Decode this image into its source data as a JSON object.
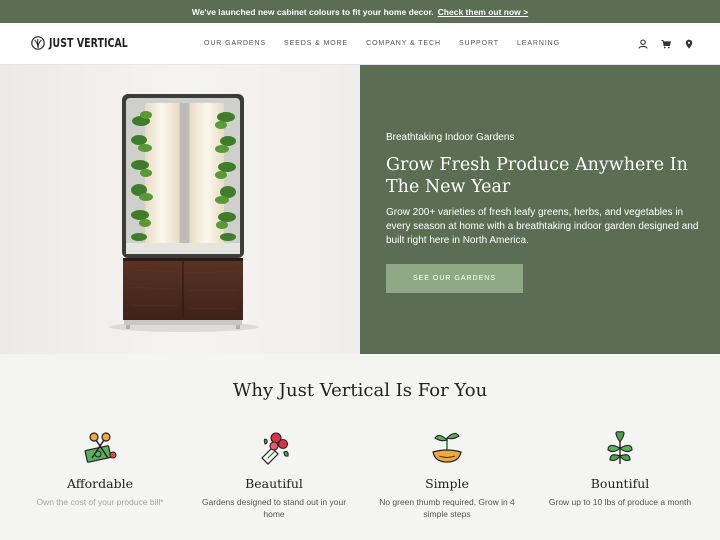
{
  "announcement": {
    "text": "We've launched new cabinet colours to fit your home decor.",
    "link": "Check them out now >"
  },
  "brand": {
    "name": "JUST VERTICAL"
  },
  "nav": {
    "items": [
      "OUR GARDENS",
      "SEEDS & MORE",
      "COMPANY & TECH",
      "SUPPORT",
      "LEARNING"
    ],
    "icons": [
      "user-icon",
      "cart-icon",
      "location-pin-icon"
    ]
  },
  "hero": {
    "eyebrow": "Breathtaking Indoor Gardens",
    "headline": "Grow Fresh Produce Anywhere In The New Year",
    "description": "Grow 200+ varieties of fresh leafy greens, herbs, and vegetables in every season at home with a breathtaking indoor garden designed and built right here in North America.",
    "cta": "SEE OUR GARDENS"
  },
  "why": {
    "title": "Why Just Vertical Is For You",
    "features": [
      {
        "icon": "scissors-money-icon",
        "title": "Affordable",
        "description": "Own the cost of your produce bill*"
      },
      {
        "icon": "flower-bouquet-icon",
        "title": "Beautiful",
        "description": "Gardens designed to stand out in your home"
      },
      {
        "icon": "seedling-hands-icon",
        "title": "Simple",
        "description": "No green thumb required. Grow in 4 simple steps"
      },
      {
        "icon": "leafy-plant-icon",
        "title": "Bountiful",
        "description": "Grow up to 10 lbs of produce a month"
      }
    ]
  },
  "colors": {
    "brand_green": "#5b6e54",
    "button_green": "#8fa886",
    "cabinet_brown": "#4a2a1f"
  }
}
